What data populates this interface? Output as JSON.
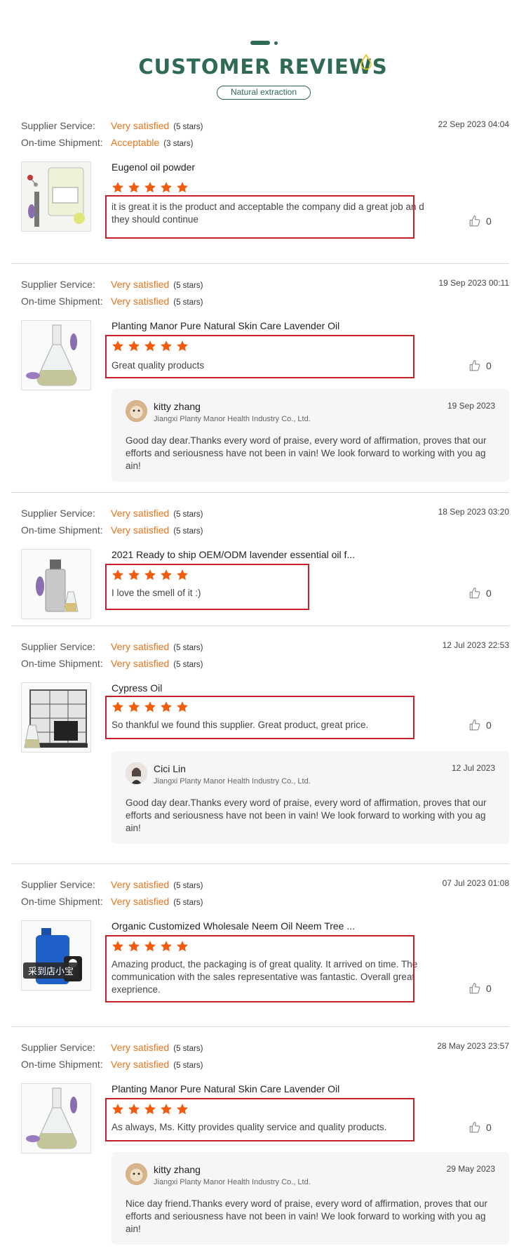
{
  "header": {
    "title": "CUSTOMER REVIEWS",
    "subtitle": "Natural extraction",
    "brand_color": "#2e6b52"
  },
  "colors": {
    "rating_orange": "#e8731c",
    "star_orange": "#f25a0c",
    "highlight_red": "#c8202a"
  },
  "reviews": [
    {
      "supplier_label": "Supplier Service:",
      "supplier_value": "Very satisfied",
      "supplier_stars": "(5 stars)",
      "shipment_label": "On-time Shipment:",
      "shipment_value": "Acceptable",
      "shipment_stars": "(3 stars)",
      "date": "22 Sep 2023 04:04",
      "product": "Eugenol oil powder",
      "rating": 5,
      "comment": "it is great it is the product and acceptable the company did a great job an d they should continue",
      "likes": "0"
    },
    {
      "supplier_label": "Supplier Service:",
      "supplier_value": "Very satisfied",
      "supplier_stars": "(5 stars)",
      "shipment_label": "On-time Shipment:",
      "shipment_value": "Very satisfied",
      "shipment_stars": "(5 stars)",
      "date": "19 Sep 2023 00:11",
      "product": "Planting Manor Pure Natural Skin Care Lavender Oil",
      "rating": 5,
      "comment": "Great quality products",
      "likes": "0",
      "reply": {
        "name": "kitty zhang",
        "company": "Jiangxi Planty Manor Health Industry Co., Ltd.",
        "date": "19 Sep 2023",
        "text": "Good day dear.Thanks every word of praise, every word of affirmation, proves that our efforts and seriousness have not been in vain! We look forward to working with you ag ain!"
      }
    },
    {
      "supplier_label": "Supplier Service:",
      "supplier_value": "Very satisfied",
      "supplier_stars": "(5 stars)",
      "shipment_label": "On-time Shipment:",
      "shipment_value": "Very satisfied",
      "shipment_stars": "(5 stars)",
      "date": "18 Sep 2023 03:20",
      "product": "2021 Ready to ship OEM/ODM lavender essential oil f...",
      "rating": 5,
      "comment": "I love the smell of it :)",
      "likes": "0"
    },
    {
      "supplier_label": "Supplier Service:",
      "supplier_value": "Very satisfied",
      "supplier_stars": "(5 stars)",
      "shipment_label": "On-time Shipment:",
      "shipment_value": "Very satisfied",
      "shipment_stars": "(5 stars)",
      "date": "12 Jul 2023 22:53",
      "product": "Cypress Oil",
      "rating": 5,
      "comment": "So thankful we found this supplier. Great product, great price.",
      "likes": "0",
      "reply": {
        "name": "Cici Lin",
        "company": "Jiangxi Planty Manor Health Industry Co., Ltd.",
        "date": "12 Jul 2023",
        "text": "Good day dear.Thanks every word of praise, every word of affirmation, proves that our efforts and seriousness have not been in vain! We look forward to working with you ag ain!"
      }
    },
    {
      "supplier_label": "Supplier Service:",
      "supplier_value": "Very satisfied",
      "supplier_stars": "(5 stars)",
      "shipment_label": "On-time Shipment:",
      "shipment_value": "Very satisfied",
      "shipment_stars": "(5 stars)",
      "date": "07 Jul 2023 01:08",
      "product": "Organic Customized Wholesale Neem Oil Neem Tree ...",
      "rating": 5,
      "comment": "Amazing product, the packaging is of great quality. It arrived on time. The communication with the sales representative was fantastic. Overall great exeprience.",
      "likes": "0",
      "image_caption": "采到店小宝"
    },
    {
      "supplier_label": "Supplier Service:",
      "supplier_value": "Very satisfied",
      "supplier_stars": "(5 stars)",
      "shipment_label": "On-time Shipment:",
      "shipment_value": "Very satisfied",
      "shipment_stars": "(5 stars)",
      "date": "28 May 2023 23:57",
      "product": "Planting Manor Pure Natural Skin Care Lavender Oil",
      "rating": 5,
      "comment": "As always, Ms. Kitty provides quality service and quality products.",
      "likes": "0",
      "reply": {
        "name": "kitty zhang",
        "company": "Jiangxi Planty Manor Health Industry Co., Ltd.",
        "date": "29 May 2023",
        "text": "Nice day friend.Thanks every word of praise, every word of affirmation, proves that our efforts and seriousness have not been in vain! We look forward to working with you ag ain!"
      }
    }
  ]
}
